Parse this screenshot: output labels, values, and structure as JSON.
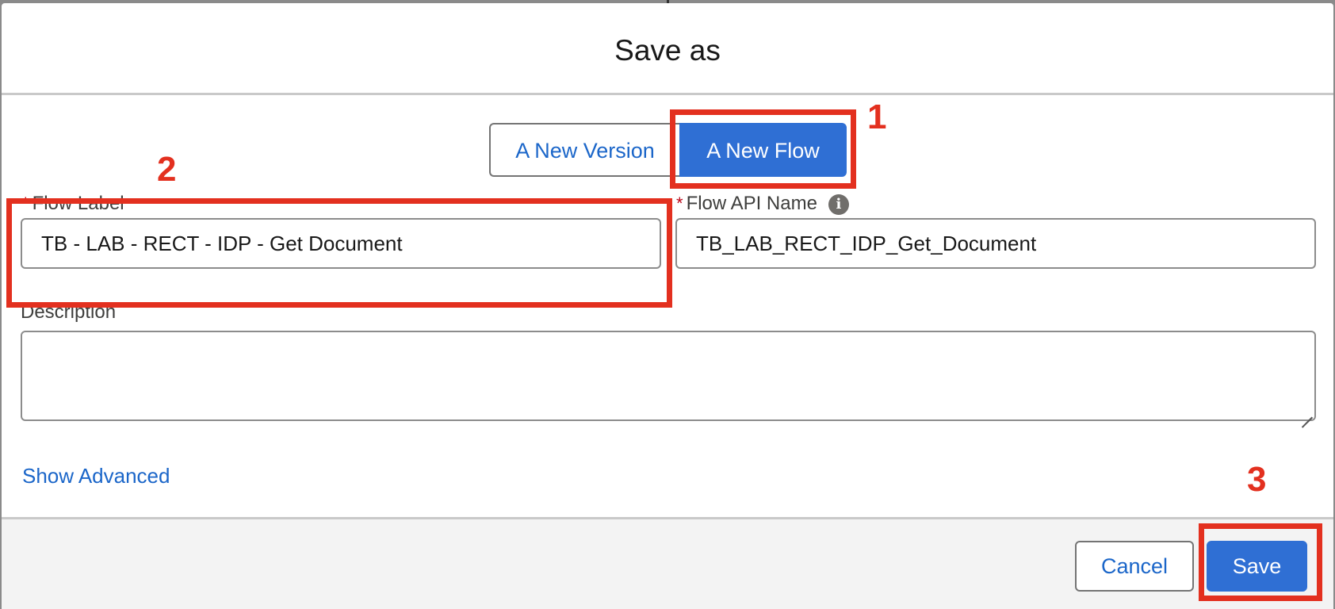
{
  "dialog": {
    "title": "Save as",
    "save_mode": {
      "options": [
        "A New Version",
        "A New Flow"
      ],
      "selected": "A New Flow"
    },
    "flow_label": {
      "label": "Flow Label",
      "required_marker": "*",
      "value": "TB - LAB - RECT - IDP - Get Document"
    },
    "flow_api_name": {
      "label": "Flow API Name",
      "required_marker": "*",
      "info_icon": "info-icon",
      "value": "TB_LAB_RECT_IDP_Get_Document"
    },
    "description": {
      "label": "Description",
      "value": ""
    },
    "show_advanced": "Show Advanced",
    "footer": {
      "cancel_label": "Cancel",
      "save_label": "Save"
    }
  },
  "annotations": {
    "color": "#e3301f",
    "labels": [
      "1",
      "2",
      "3"
    ]
  },
  "colors": {
    "brand_blue": "#2f6fd4",
    "link_blue": "#1b66c9",
    "required_red": "#ba0517"
  }
}
